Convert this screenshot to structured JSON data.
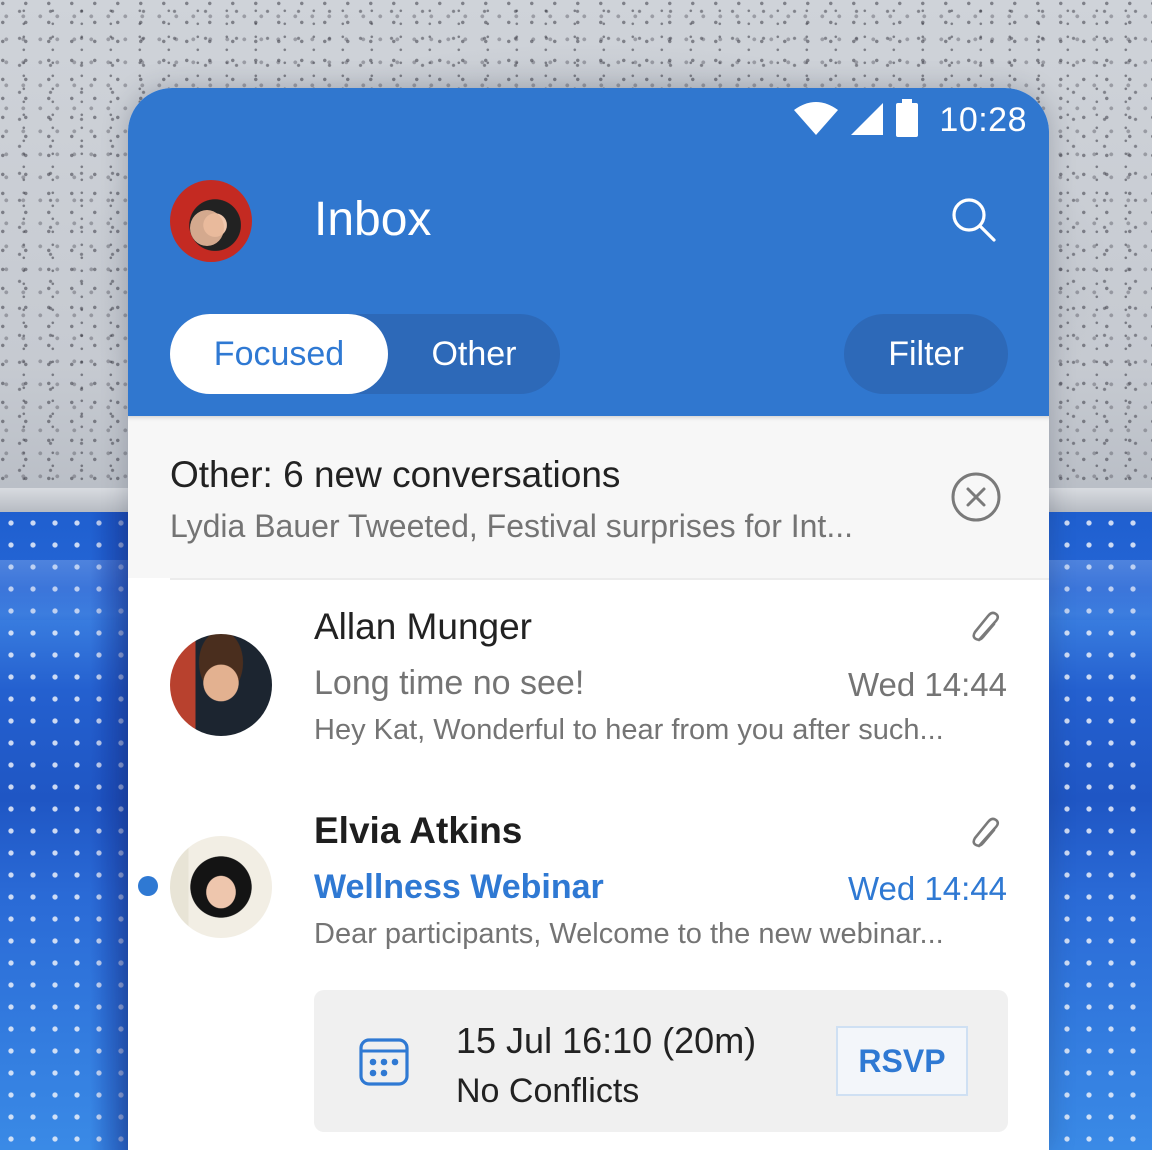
{
  "status_bar": {
    "time": "10:28",
    "icons": [
      "wifi-icon",
      "cellular-signal-icon",
      "battery-icon"
    ]
  },
  "header": {
    "title": "Inbox",
    "avatar_alt": "Account avatar",
    "search_icon": "search-icon"
  },
  "pivots": {
    "focused_label": "Focused",
    "other_label": "Other",
    "selected": "Focused"
  },
  "filter": {
    "label": "Filter"
  },
  "other_banner": {
    "title": "Other: 6 new conversations",
    "subtitle": "Lydia Bauer Tweeted, Festival surprises for Int...",
    "close_icon": "close-circle-icon"
  },
  "messages": [
    {
      "sender": "Allan Munger",
      "subject": "Long time no see!",
      "time": "Wed 14:44",
      "preview": "Hey Kat, Wonderful to hear from you after such...",
      "has_attachment": true,
      "unread": false
    },
    {
      "sender": "Elvia Atkins",
      "subject": "Wellness Webinar",
      "time": "Wed 14:44",
      "preview": "Dear participants, Welcome to the new webinar...",
      "has_attachment": true,
      "unread": true,
      "event": {
        "when": "15 Jul 16:10 (20m)",
        "conflicts": "No Conflicts",
        "rsvp_label": "RSVP"
      }
    }
  ],
  "colors": {
    "accent": "#2f79d3",
    "header_bg": "#3077cf",
    "pivot_bg": "#2d69b8",
    "banner_bg": "#f7f7f7",
    "event_card_bg": "#f0f0f0",
    "text_primary": "#222222",
    "text_secondary": "#747474"
  }
}
